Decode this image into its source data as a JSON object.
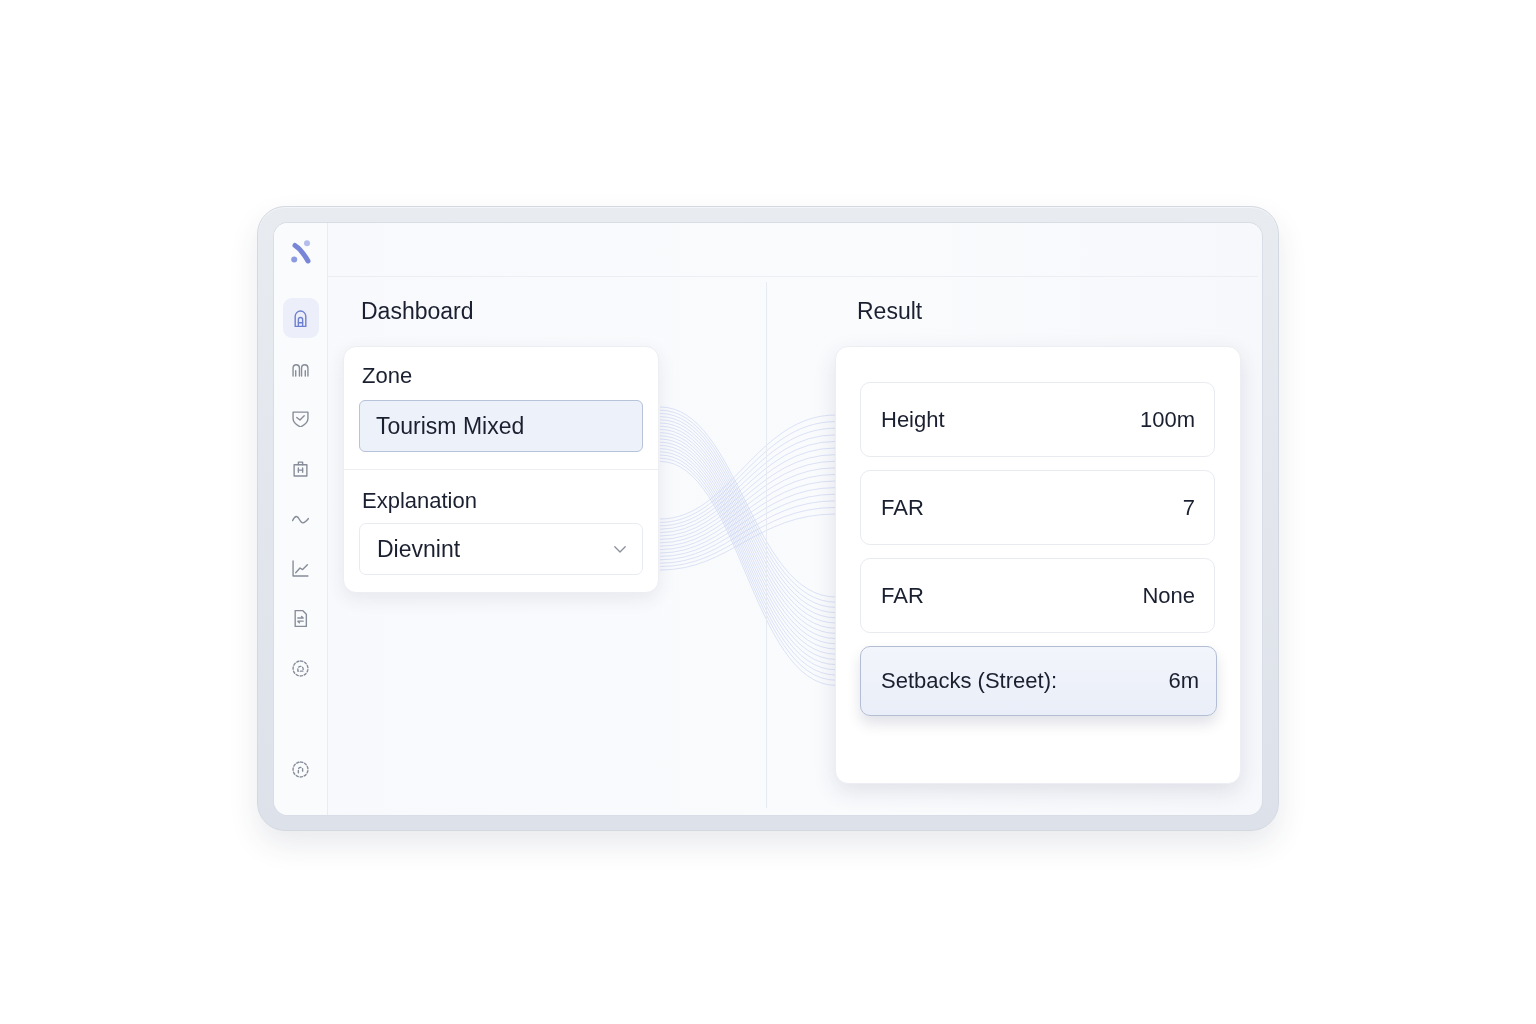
{
  "sidebar": {
    "items": [
      {
        "selected": true
      },
      {
        "selected": false
      },
      {
        "selected": false
      },
      {
        "selected": false
      },
      {
        "selected": false
      },
      {
        "selected": false
      },
      {
        "selected": false
      },
      {
        "selected": false
      }
    ]
  },
  "dashboard": {
    "title": "Dashboard",
    "zone": {
      "label": "Zone",
      "value": "Tourism Mixed"
    },
    "explanation": {
      "label": "Explanation",
      "value": "Dievnint"
    }
  },
  "result": {
    "title": "Result",
    "rows": [
      {
        "label": "Height",
        "value": "100m",
        "selected": false
      },
      {
        "label": "FAR",
        "value": "7",
        "selected": false
      },
      {
        "label": "FAR",
        "value": "None",
        "selected": false
      },
      {
        "label": "Setbacks (Street):",
        "value": "6m",
        "selected": true
      }
    ]
  }
}
